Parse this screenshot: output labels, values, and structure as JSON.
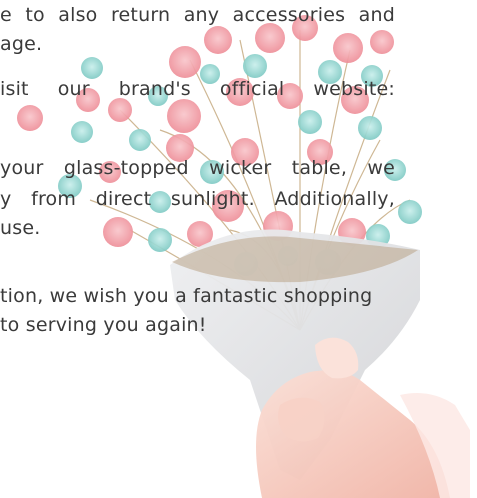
{
  "document": {
    "lines": [
      "e to also return any accessories and",
      "age.",
      "isit our brand's official website:",
      "your glass-topped wicker table, we",
      "y from direct sunlight. Additionally,",
      "use.",
      "tion, we wish you a fantastic shopping",
      "to serving you again!"
    ]
  },
  "colors": {
    "text": "#3a3a3a",
    "flower_pink": "#f2a0a8",
    "flower_teal": "#8fd4cf",
    "stem_brown": "#b89a6e",
    "wrap_gray": "#d9dadc",
    "hand_skin": "#f6c9bd"
  }
}
